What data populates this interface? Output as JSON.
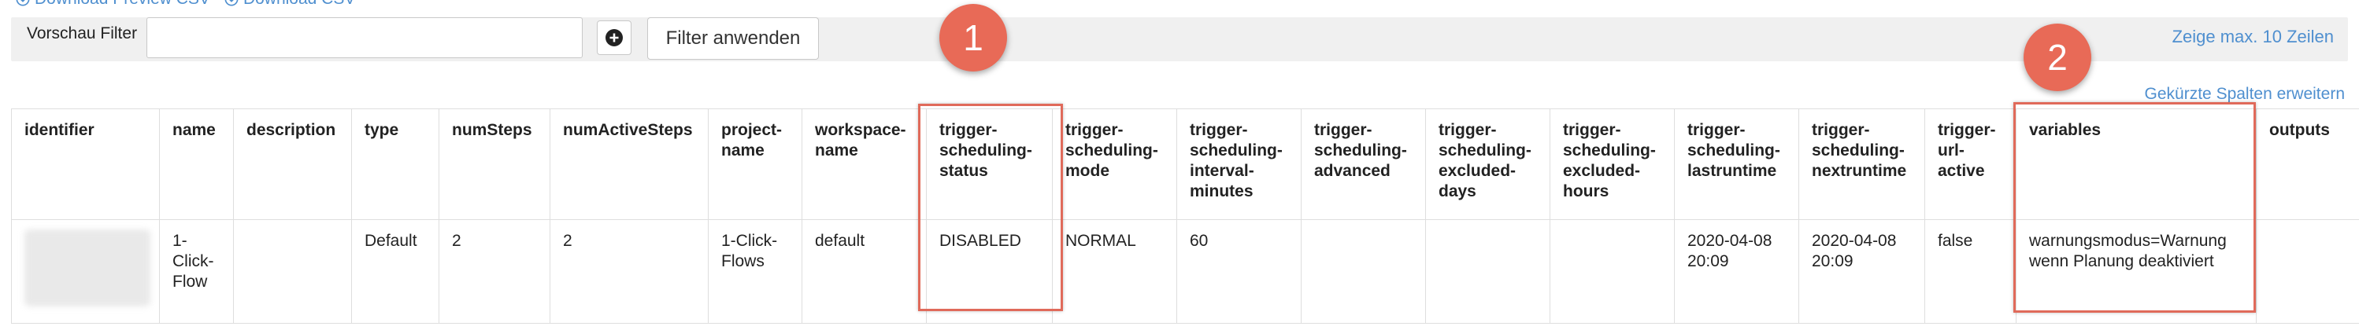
{
  "links": {
    "download_preview": "Download Preview CSV",
    "download_csv": "Download CSV"
  },
  "filter": {
    "label": "Vorschau Filter",
    "input_value": "",
    "input_placeholder": "",
    "apply_label": "Filter anwenden",
    "max_rows": "Zeige max. 10 Zeilen"
  },
  "expand_columns": "Gekürzte Spalten erweitern",
  "table": {
    "headers": [
      "identifier",
      "name",
      "description",
      "type",
      "numSteps",
      "numActiveSteps",
      "project-name",
      "workspace-name",
      "trigger-scheduling-status",
      "trigger-scheduling-mode",
      "trigger-scheduling-interval-minutes",
      "trigger-scheduling-advanced",
      "trigger-scheduling-excluded-days",
      "trigger-scheduling-excluded-hours",
      "trigger-scheduling-lastruntime",
      "trigger-scheduling-nextruntime",
      "trigger-url-active",
      "variables",
      "outputs"
    ],
    "row": [
      "",
      "1-Click-Flow",
      "",
      "Default",
      "2",
      "2",
      "1-Click-Flows",
      "default",
      "DISABLED",
      "NORMAL",
      "60",
      "",
      "",
      "",
      "2020-04-08 20:09",
      "2020-04-08 20:09",
      "false",
      "warnungsmodus=Warnung wenn Planung deaktiviert",
      ""
    ]
  },
  "annotations": {
    "badge_1": "1",
    "badge_2": "2",
    "color": "#e06a5a"
  },
  "icons": {
    "download": "download-circle-icon",
    "add": "plus-circle-icon"
  }
}
